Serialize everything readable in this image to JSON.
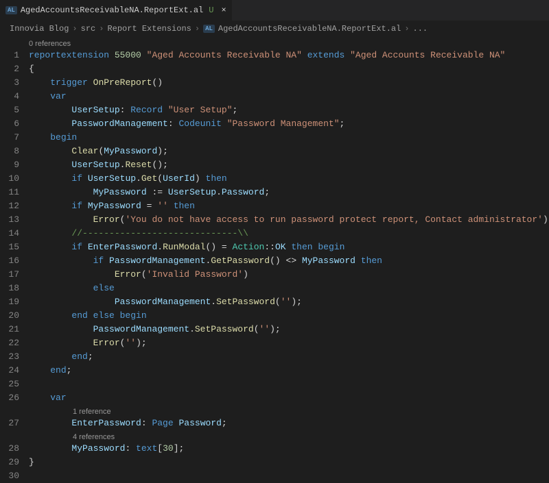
{
  "tab": {
    "badge": "AL",
    "filename": "AgedAccountsReceivableNA.ReportExt.al",
    "modified": "U",
    "close": "×"
  },
  "breadcrumb": {
    "items": [
      "Innovia Blog",
      "src",
      "Report Extensions"
    ],
    "badge": "AL",
    "file": "AgedAccountsReceivableNA.ReportExt.al",
    "more": "...",
    "sep": "›"
  },
  "codelens": {
    "top": "0 references",
    "enterPassword": "1 reference",
    "myPassword": "4 references"
  },
  "lines": {
    "l1": {
      "a": "reportextension",
      "b": " 55000 ",
      "c": "\"Aged Accounts Receivable NA\"",
      "d": " ",
      "e": "extends",
      "f": " ",
      "g": "\"Aged Accounts Receivable NA\""
    },
    "l2": "{",
    "l3": {
      "a": "    ",
      "b": "trigger",
      "c": " ",
      "d": "OnPreReport",
      "e": "()"
    },
    "l4": {
      "a": "    ",
      "b": "var"
    },
    "l5": {
      "a": "        ",
      "b": "UserSetup",
      "c": ": ",
      "d": "Record",
      "e": " ",
      "f": "\"User Setup\"",
      "g": ";"
    },
    "l6": {
      "a": "        ",
      "b": "PasswordManagement",
      "c": ": ",
      "d": "Codeunit",
      "e": " ",
      "f": "\"Password Management\"",
      "g": ";"
    },
    "l7": {
      "a": "    ",
      "b": "begin"
    },
    "l8": {
      "a": "        ",
      "b": "Clear",
      "c": "(",
      "d": "MyPassword",
      "e": ");"
    },
    "l9": {
      "a": "        ",
      "b": "UserSetup",
      "c": ".",
      "d": "Reset",
      "e": "();"
    },
    "l10": {
      "a": "        ",
      "b": "if",
      "c": " ",
      "d": "UserSetup",
      "e": ".",
      "f": "Get",
      "g": "(",
      "h": "UserId",
      "i": ") ",
      "j": "then"
    },
    "l11": {
      "a": "            ",
      "b": "MyPassword",
      "c": " := ",
      "d": "UserSetup",
      "e": ".",
      "f": "Password",
      "g": ";"
    },
    "l12": {
      "a": "        ",
      "b": "if",
      "c": " ",
      "d": "MyPassword",
      "e": " = ",
      "f": "''",
      "g": " ",
      "h": "then"
    },
    "l13": {
      "a": "            ",
      "b": "Error",
      "c": "(",
      "d": "'You do not have access to run password protect report, Contact administrator'",
      "e": ");"
    },
    "l14": {
      "a": "        ",
      "b": "//-----------------------------\\\\"
    },
    "l15": {
      "a": "        ",
      "b": "if",
      "c": " ",
      "d": "EnterPassword",
      "e": ".",
      "f": "RunModal",
      "g": "() = ",
      "h": "Action",
      "i": "::",
      "j": "OK",
      "k": " ",
      "l": "then begin"
    },
    "l16": {
      "a": "            ",
      "b": "if",
      "c": " ",
      "d": "PasswordManagement",
      "e": ".",
      "f": "GetPassword",
      "g": "() <> ",
      "h": "MyPassword",
      "i": " ",
      "j": "then"
    },
    "l17": {
      "a": "                ",
      "b": "Error",
      "c": "(",
      "d": "'Invalid Password'",
      "e": ")"
    },
    "l18": {
      "a": "            ",
      "b": "else"
    },
    "l19": {
      "a": "                ",
      "b": "PasswordManagement",
      "c": ".",
      "d": "SetPassword",
      "e": "(",
      "f": "''",
      "g": ");"
    },
    "l20": {
      "a": "        ",
      "b": "end else begin"
    },
    "l21": {
      "a": "            ",
      "b": "PasswordManagement",
      "c": ".",
      "d": "SetPassword",
      "e": "(",
      "f": "''",
      "g": ");"
    },
    "l22": {
      "a": "            ",
      "b": "Error",
      "c": "(",
      "d": "''",
      "e": ");"
    },
    "l23": {
      "a": "        ",
      "b": "end",
      "c": ";"
    },
    "l24": {
      "a": "    ",
      "b": "end",
      "c": ";"
    },
    "l25": "",
    "l26": {
      "a": "    ",
      "b": "var"
    },
    "l27": {
      "a": "        ",
      "b": "EnterPassword",
      "c": ": ",
      "d": "Page",
      "e": " ",
      "f": "Password",
      "g": ";"
    },
    "l28": {
      "a": "        ",
      "b": "MyPassword",
      "c": ": ",
      "d": "text",
      "e": "[",
      "f": "30",
      "g": "];"
    },
    "l29": "}",
    "l30": ""
  },
  "lineNumbers": [
    "1",
    "2",
    "3",
    "4",
    "5",
    "6",
    "7",
    "8",
    "9",
    "10",
    "11",
    "12",
    "13",
    "14",
    "15",
    "16",
    "17",
    "18",
    "19",
    "20",
    "21",
    "22",
    "23",
    "24",
    "25",
    "26",
    "27",
    "28",
    "29",
    "30"
  ]
}
